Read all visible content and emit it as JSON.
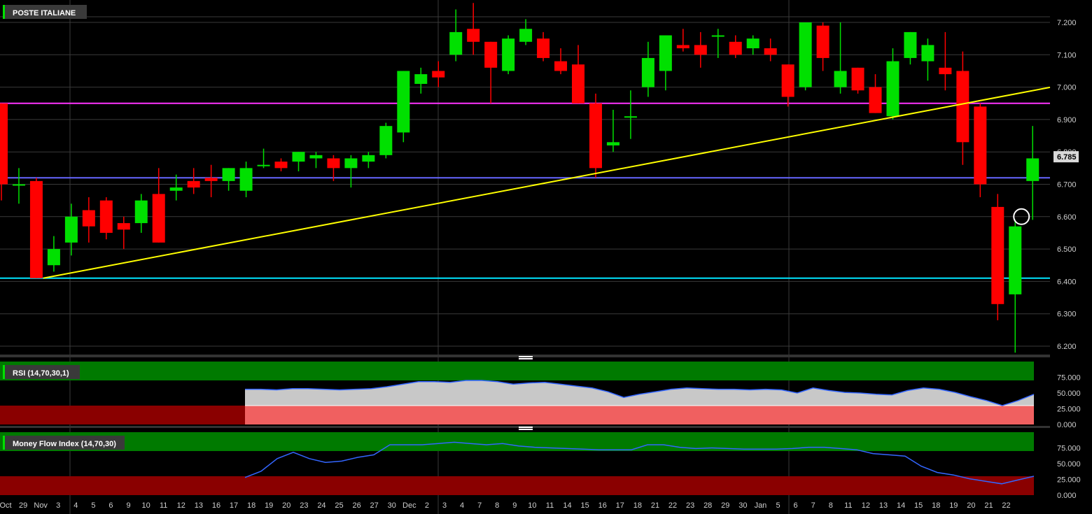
{
  "colors": {
    "background": "#000000",
    "grid": "#3a3a3a",
    "up": "#00e000",
    "down": "#ff0000",
    "trendline": "#ffff00",
    "resistance": "#ff33ff",
    "support_mid": "#6666ff",
    "support_low": "#00e5ff",
    "zone_green": "#007a00",
    "zone_red": "#8a0000",
    "rsi_line": "#3366ff",
    "current_price_box": "#d9d9d9"
  },
  "chart_data": [
    {
      "type": "candlestick",
      "title": "POSTE ITALIANE",
      "ylim": [
        6.18,
        7.26
      ],
      "y_ticks": [
        "7.200",
        "7.100",
        "7.000",
        "6.900",
        "6.800",
        "6.700",
        "6.600",
        "6.500",
        "6.400",
        "6.300",
        "6.200"
      ],
      "current_price": "6.785",
      "x_labels": [
        "Oct",
        "29",
        "Nov",
        "3",
        "4",
        "5",
        "6",
        "9",
        "10",
        "11",
        "12",
        "13",
        "16",
        "17",
        "18",
        "19",
        "20",
        "23",
        "24",
        "25",
        "26",
        "27",
        "30",
        "Dec",
        "2",
        "3",
        "4",
        "7",
        "8",
        "9",
        "10",
        "11",
        "14",
        "15",
        "16",
        "17",
        "18",
        "21",
        "22",
        "23",
        "28",
        "29",
        "30",
        "Jan",
        "5",
        "6",
        "7",
        "8",
        "11",
        "12",
        "13",
        "14",
        "15",
        "18",
        "19",
        "20",
        "21",
        "22"
      ],
      "candles": [
        {
          "x": "Oct",
          "o": 6.95,
          "h": 6.95,
          "l": 6.65,
          "c": 6.7
        },
        {
          "x": "",
          "o": 6.7,
          "h": 6.75,
          "l": 6.64,
          "c": 6.7
        },
        {
          "x": "29",
          "o": 6.71,
          "h": 6.72,
          "l": 6.41,
          "c": 6.41
        },
        {
          "x": "30",
          "o": 6.45,
          "h": 6.54,
          "l": 6.43,
          "c": 6.5
        },
        {
          "x": "Nov",
          "o": 6.52,
          "h": 6.64,
          "l": 6.48,
          "c": 6.6
        },
        {
          "x": "3",
          "o": 6.62,
          "h": 6.66,
          "l": 6.52,
          "c": 6.57
        },
        {
          "x": "4",
          "o": 6.65,
          "h": 6.66,
          "l": 6.53,
          "c": 6.55
        },
        {
          "x": "5",
          "o": 6.58,
          "h": 6.6,
          "l": 6.5,
          "c": 6.56
        },
        {
          "x": "6",
          "o": 6.58,
          "h": 6.67,
          "l": 6.55,
          "c": 6.65
        },
        {
          "x": "9",
          "o": 6.67,
          "h": 6.75,
          "l": 6.52,
          "c": 6.52
        },
        {
          "x": "10",
          "o": 6.68,
          "h": 6.73,
          "l": 6.65,
          "c": 6.69
        },
        {
          "x": "11",
          "o": 6.71,
          "h": 6.75,
          "l": 6.67,
          "c": 6.69
        },
        {
          "x": "12",
          "o": 6.72,
          "h": 6.76,
          "l": 6.66,
          "c": 6.71
        },
        {
          "x": "13",
          "o": 6.71,
          "h": 6.75,
          "l": 6.68,
          "c": 6.75
        },
        {
          "x": "16",
          "o": 6.68,
          "h": 6.77,
          "l": 6.66,
          "c": 6.75
        },
        {
          "x": "17",
          "o": 6.76,
          "h": 6.81,
          "l": 6.75,
          "c": 6.76
        },
        {
          "x": "18",
          "o": 6.77,
          "h": 6.78,
          "l": 6.74,
          "c": 6.75
        },
        {
          "x": "19",
          "o": 6.77,
          "h": 6.8,
          "l": 6.74,
          "c": 6.8
        },
        {
          "x": "20",
          "o": 6.78,
          "h": 6.8,
          "l": 6.75,
          "c": 6.79
        },
        {
          "x": "23",
          "o": 6.78,
          "h": 6.79,
          "l": 6.71,
          "c": 6.75
        },
        {
          "x": "24",
          "o": 6.75,
          "h": 6.79,
          "l": 6.69,
          "c": 6.78
        },
        {
          "x": "25",
          "o": 6.77,
          "h": 6.8,
          "l": 6.75,
          "c": 6.79
        },
        {
          "x": "26",
          "o": 6.79,
          "h": 6.89,
          "l": 6.78,
          "c": 6.88
        },
        {
          "x": "27",
          "o": 6.86,
          "h": 7.05,
          "l": 6.83,
          "c": 7.05
        },
        {
          "x": "30",
          "o": 7.01,
          "h": 7.06,
          "l": 6.98,
          "c": 7.04
        },
        {
          "x": "Dec",
          "o": 7.05,
          "h": 7.08,
          "l": 7.0,
          "c": 7.03
        },
        {
          "x": "2",
          "o": 7.1,
          "h": 7.24,
          "l": 7.08,
          "c": 7.17
        },
        {
          "x": "3",
          "o": 7.18,
          "h": 7.26,
          "l": 7.1,
          "c": 7.14
        },
        {
          "x": "4",
          "o": 7.14,
          "h": 7.14,
          "l": 6.95,
          "c": 7.06
        },
        {
          "x": "7",
          "o": 7.05,
          "h": 7.16,
          "l": 7.04,
          "c": 7.15
        },
        {
          "x": "8",
          "o": 7.14,
          "h": 7.21,
          "l": 7.13,
          "c": 7.18
        },
        {
          "x": "9",
          "o": 7.15,
          "h": 7.17,
          "l": 7.08,
          "c": 7.09
        },
        {
          "x": "10",
          "o": 7.08,
          "h": 7.12,
          "l": 7.04,
          "c": 7.05
        },
        {
          "x": "11",
          "o": 7.07,
          "h": 7.13,
          "l": 6.95,
          "c": 6.95
        },
        {
          "x": "14",
          "o": 6.95,
          "h": 6.98,
          "l": 6.72,
          "c": 6.75
        },
        {
          "x": "15",
          "o": 6.82,
          "h": 6.93,
          "l": 6.8,
          "c": 6.83
        },
        {
          "x": "16",
          "o": 6.91,
          "h": 6.99,
          "l": 6.84,
          "c": 6.91
        },
        {
          "x": "17",
          "o": 7.0,
          "h": 7.14,
          "l": 6.97,
          "c": 7.09
        },
        {
          "x": "18",
          "o": 7.05,
          "h": 7.16,
          "l": 6.99,
          "c": 7.16
        },
        {
          "x": "21",
          "o": 7.13,
          "h": 7.18,
          "l": 7.11,
          "c": 7.12
        },
        {
          "x": "22",
          "o": 7.13,
          "h": 7.17,
          "l": 7.06,
          "c": 7.1
        },
        {
          "x": "23",
          "o": 7.16,
          "h": 7.18,
          "l": 7.09,
          "c": 7.16
        },
        {
          "x": "28",
          "o": 7.14,
          "h": 7.16,
          "l": 7.09,
          "c": 7.1
        },
        {
          "x": "29",
          "o": 7.12,
          "h": 7.16,
          "l": 7.1,
          "c": 7.15
        },
        {
          "x": "30",
          "o": 7.12,
          "h": 7.15,
          "l": 7.08,
          "c": 7.1
        },
        {
          "x": "Jan",
          "o": 7.07,
          "h": 7.07,
          "l": 6.94,
          "c": 6.97
        },
        {
          "x": "5",
          "o": 7.0,
          "h": 7.2,
          "l": 6.99,
          "c": 7.2
        },
        {
          "x": "6",
          "o": 7.19,
          "h": 7.2,
          "l": 7.05,
          "c": 7.09
        },
        {
          "x": "7",
          "o": 7.0,
          "h": 7.2,
          "l": 6.98,
          "c": 7.05
        },
        {
          "x": "8",
          "o": 7.06,
          "h": 7.06,
          "l": 6.98,
          "c": 6.99
        },
        {
          "x": "11",
          "o": 7.0,
          "h": 7.04,
          "l": 6.92,
          "c": 6.92
        },
        {
          "x": "12",
          "o": 6.91,
          "h": 7.12,
          "l": 6.9,
          "c": 7.08
        },
        {
          "x": "13",
          "o": 7.09,
          "h": 7.17,
          "l": 7.07,
          "c": 7.17
        },
        {
          "x": "14",
          "o": 7.08,
          "h": 7.15,
          "l": 7.02,
          "c": 7.13
        },
        {
          "x": "15",
          "o": 7.06,
          "h": 7.17,
          "l": 6.99,
          "c": 7.04
        },
        {
          "x": "18",
          "o": 7.05,
          "h": 7.11,
          "l": 6.76,
          "c": 6.83
        },
        {
          "x": "19",
          "o": 6.94,
          "h": 6.95,
          "l": 6.66,
          "c": 6.7
        },
        {
          "x": "20",
          "o": 6.63,
          "h": 6.67,
          "l": 6.28,
          "c": 6.33
        },
        {
          "x": "21",
          "o": 6.36,
          "h": 6.59,
          "l": 6.18,
          "c": 6.57
        },
        {
          "x": "22",
          "o": 6.71,
          "h": 6.88,
          "l": 6.59,
          "c": 6.78
        }
      ],
      "horizontal_levels": [
        6.95,
        6.72,
        6.41
      ],
      "trendline": {
        "from": {
          "x": "29",
          "y": 6.41
        },
        "to": {
          "x": "22",
          "y": 6.99
        }
      },
      "marker": {
        "x": "22",
        "y": 6.6
      }
    },
    {
      "type": "area",
      "title": "RSI (14,70,30,1)",
      "ylim": [
        0,
        100
      ],
      "y_ticks": [
        "75.000",
        "50.000",
        "25.000",
        "0.000"
      ],
      "overbought": 70,
      "oversold": 30,
      "values": [
        56,
        56,
        55,
        57,
        57,
        56,
        55,
        56,
        57,
        60,
        64,
        68,
        68,
        67,
        70,
        70,
        68,
        64,
        66,
        67,
        64,
        61,
        58,
        52,
        43,
        48,
        52,
        56,
        58,
        57,
        56,
        56,
        55,
        56,
        55,
        50,
        58,
        54,
        51,
        50,
        48,
        47,
        54,
        58,
        56,
        51,
        44,
        38,
        30,
        38,
        48
      ]
    },
    {
      "type": "line",
      "title": "Money Flow Index (14,70,30)",
      "ylim": [
        0,
        100
      ],
      "y_ticks": [
        "75.000",
        "50.000",
        "25.000",
        "0.000"
      ],
      "overbought": 70,
      "oversold": 30,
      "values": [
        28,
        38,
        58,
        68,
        58,
        52,
        54,
        60,
        64,
        80,
        80,
        80,
        82,
        84,
        82,
        80,
        82,
        78,
        76,
        75,
        74,
        73,
        72,
        72,
        72,
        80,
        80,
        76,
        74,
        75,
        74,
        73,
        73,
        73,
        74,
        76,
        76,
        74,
        72,
        66,
        64,
        62,
        46,
        36,
        32,
        26,
        22,
        18,
        24,
        30
      ]
    }
  ]
}
